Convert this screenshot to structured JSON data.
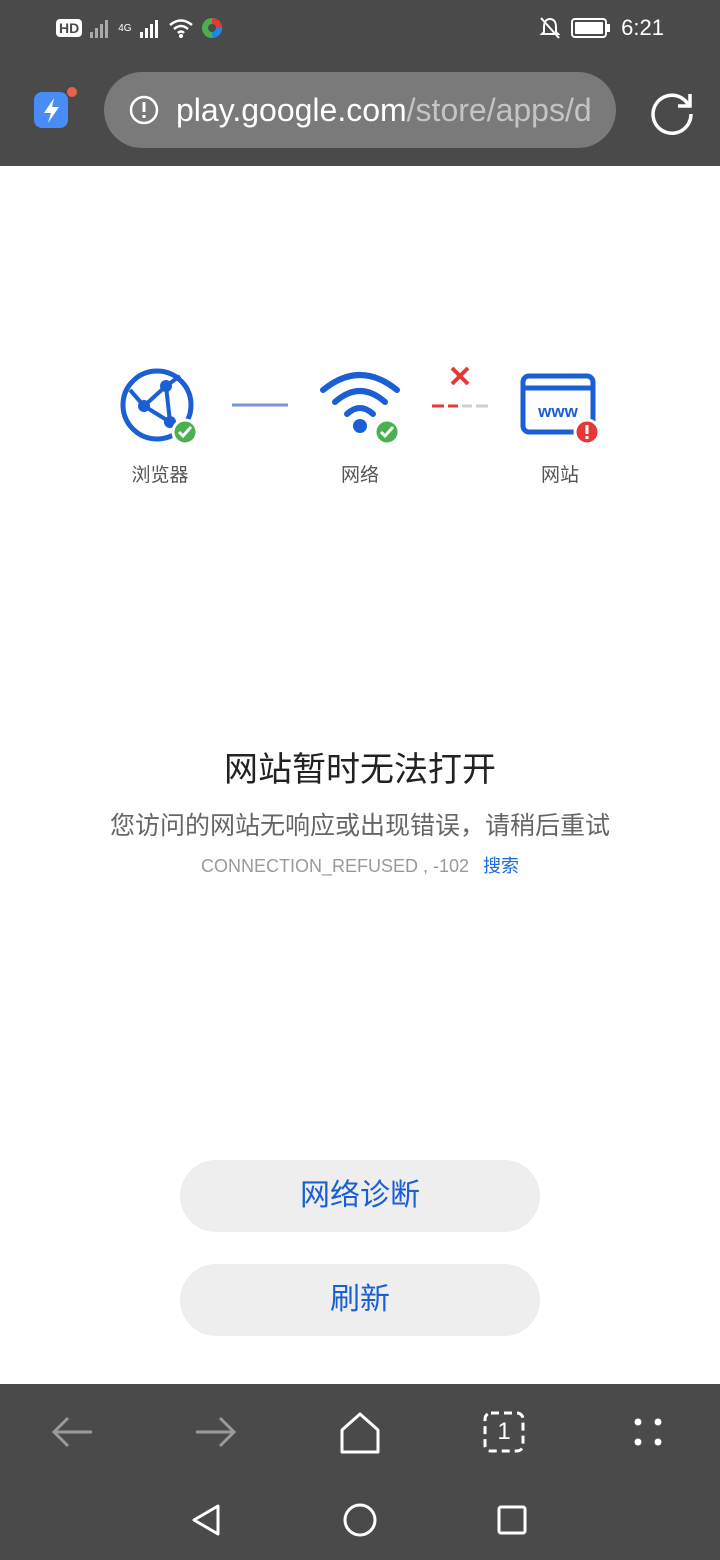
{
  "status_bar": {
    "hd_badge": "HD",
    "network_type": "4G",
    "time": "6:21",
    "icons": [
      "hd-icon",
      "signal-icon",
      "signal-4g-icon",
      "wifi-icon",
      "app-notification-icon",
      "mute-icon",
      "battery-icon"
    ]
  },
  "address_bar": {
    "url_host": "play.google.com",
    "url_path": "/store/apps/d",
    "icons": [
      "app-logo-icon",
      "info-icon",
      "reload-icon"
    ]
  },
  "diagram": {
    "browser_label": "浏览器",
    "network_label": "网络",
    "website_label": "网站",
    "website_badge": "www",
    "browser_status": "ok",
    "network_status": "ok",
    "website_status": "error"
  },
  "error": {
    "title": "网站暂时无法打开",
    "description": "您访问的网站无响应或出现错误，请稍后重试",
    "code": "CONNECTION_REFUSED , -102",
    "search_link": "搜索"
  },
  "buttons": {
    "diagnose": "网络诊断",
    "refresh": "刷新"
  },
  "toolbar": {
    "tab_count": "1",
    "icons": [
      "back-icon",
      "forward-icon",
      "home-icon",
      "tabs-icon",
      "more-icon"
    ]
  },
  "navbar": {
    "icons": [
      "nav-back-icon",
      "nav-home-icon",
      "nav-recents-icon"
    ]
  },
  "colors": {
    "accent_blue": "#1a5fd4",
    "ok_green": "#4caf50",
    "error_red": "#e53935",
    "chrome_gray": "#4a4a4a"
  }
}
